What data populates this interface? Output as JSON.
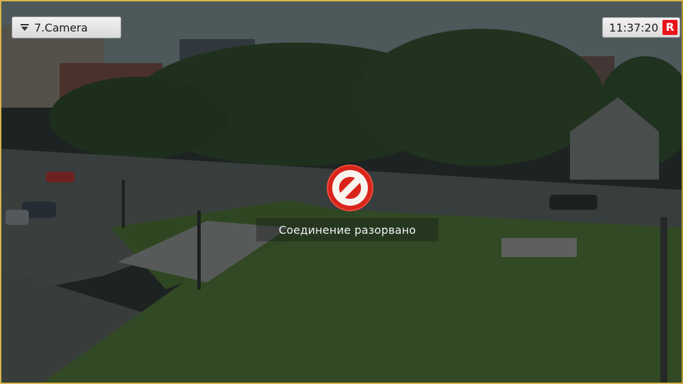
{
  "camera": {
    "name": "7.Camera",
    "dropdown_icon": "dropdown-menu-icon"
  },
  "clock": {
    "time": "11:37:20",
    "record_indicator": "R",
    "record_color": "#e8141a"
  },
  "status": {
    "message": "Соединение разорвано",
    "icon": "no-connection-icon",
    "icon_color": "#e5261c"
  },
  "frame": {
    "border_color": "#d9b54a"
  }
}
